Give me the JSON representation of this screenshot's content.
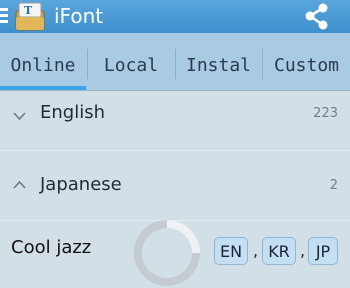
{
  "app": {
    "title": "iFont",
    "icons": {
      "menu": "menu-icon",
      "app": "app-icon",
      "share": "share-icon"
    },
    "colors": {
      "actionbar": "#4a9ad6",
      "tabbar": "#a9cae3",
      "accent": "#3ba4e6",
      "background": "#d3dfe6"
    }
  },
  "tabs": [
    {
      "label": "Online",
      "selected": true
    },
    {
      "label": "Local",
      "selected": false
    },
    {
      "label": "Instal",
      "selected": false
    },
    {
      "label": "Custom",
      "selected": false
    }
  ],
  "groups": [
    {
      "label": "English",
      "count": "223",
      "expanded": false,
      "icon": "chevron-down-icon"
    },
    {
      "label": "Japanese",
      "count": "2",
      "expanded": true,
      "icon": "chevron-up-icon"
    }
  ],
  "font_item": {
    "name": "Cool jazz",
    "loading": true,
    "languages": [
      "EN",
      "KR",
      "JP"
    ],
    "separator": ","
  }
}
